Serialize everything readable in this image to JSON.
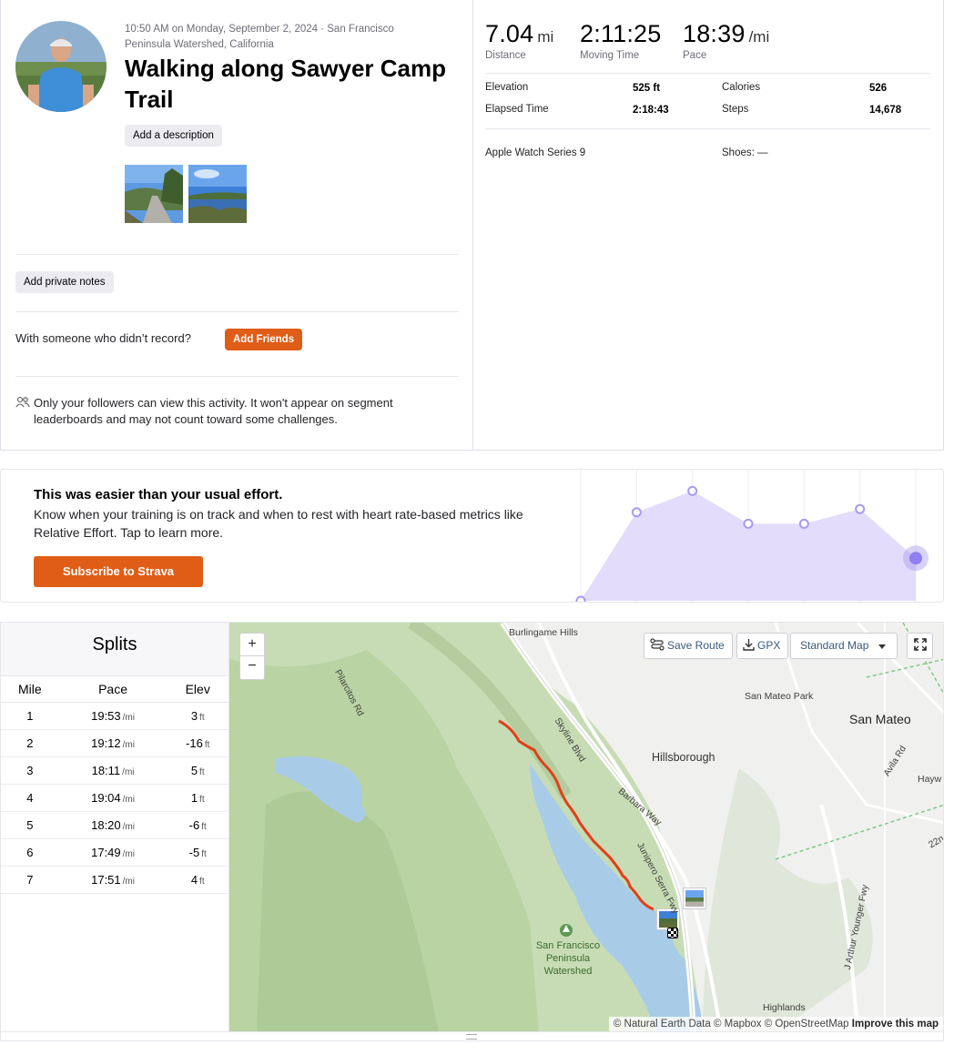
{
  "activity": {
    "meta": "10:50 AM on Monday, September 2, 2024 · San Francisco Peninsula Watershed, California",
    "title": "Walking along Sawyer Camp Trail",
    "add_description": "Add a description",
    "add_private_notes": "Add private notes",
    "someone_prompt": "With someone who didn’t record?",
    "add_friends": "Add Friends",
    "privacy_note": "Only your followers can view this activity. It won't appear on segment leaderboards and may not count toward some challenges."
  },
  "stats": {
    "distance": {
      "value": "7.04",
      "unit": "mi",
      "label": "Distance"
    },
    "moving_time": {
      "value": "2:11:25",
      "label": "Moving Time"
    },
    "pace": {
      "value": "18:39",
      "unit": "/mi",
      "label": "Pace"
    },
    "details": [
      {
        "label": "Elevation",
        "value": "525 ft"
      },
      {
        "label": "Calories",
        "value": "526"
      },
      {
        "label": "Elapsed Time",
        "value": "2:18:43"
      },
      {
        "label": "Steps",
        "value": "14,678"
      }
    ],
    "device": "Apple Watch Series 9",
    "shoes": "Shoes: —"
  },
  "effort": {
    "title": "This was easier than your usual effort.",
    "text": "Know when your training is on track and when to rest with heart rate-based metrics like Relative Effort. Tap to learn more.",
    "button": "Subscribe to Strava",
    "colors": {
      "fill": "#e3dcfb",
      "dot": "#a99af0",
      "highlight": "#8f7ff0"
    }
  },
  "chart_data": {
    "type": "area",
    "x": [
      1,
      2,
      3,
      4,
      5,
      6,
      7
    ],
    "values": [
      0,
      54,
      67,
      47,
      47,
      56,
      26
    ],
    "highlight_index": 6,
    "ylim": [
      0,
      80
    ]
  },
  "splits": {
    "title": "Splits",
    "headers": [
      "Mile",
      "Pace",
      "Elev"
    ],
    "pace_unit": "/mi",
    "elev_unit": "ft",
    "rows": [
      {
        "mile": "1",
        "pace": "19:53",
        "elev": "3"
      },
      {
        "mile": "2",
        "pace": "19:12",
        "elev": "-16"
      },
      {
        "mile": "3",
        "pace": "18:11",
        "elev": "5"
      },
      {
        "mile": "4",
        "pace": "19:04",
        "elev": "1"
      },
      {
        "mile": "5",
        "pace": "18:20",
        "elev": "-6"
      },
      {
        "mile": "6",
        "pace": "17:49",
        "elev": "-5"
      },
      {
        "mile": "7",
        "pace": "17:51",
        "elev": "4"
      }
    ]
  },
  "map": {
    "zoom_in": "+",
    "zoom_out": "−",
    "save_route": "Save Route",
    "gpx": "GPX",
    "map_style": "Standard Map",
    "labels": {
      "burlingame_hills": "Burlingame Hills",
      "san_mateo_park": "San Mateo Park",
      "san_mateo": "San Mateo",
      "hillsborough": "Hillsborough",
      "skyline": "Skyline Blvd",
      "barbara": "Barbara Way",
      "junipero": "Junipero Serra Fwy",
      "pilarcitos": "Pilarcitos Rd",
      "watershed": "San Francisco Peninsula Watershed",
      "avila": "Avila Rd",
      "hayward": "Hayw",
      "highlands": "Highlands",
      "j_arthur": "J Arthur Younger Fwy",
      "twenty_second": "22n"
    },
    "attribution": "© Natural Earth Data © Mapbox © OpenStreetMap",
    "improve": "Improve this map",
    "route_color": "#e0401a"
  }
}
